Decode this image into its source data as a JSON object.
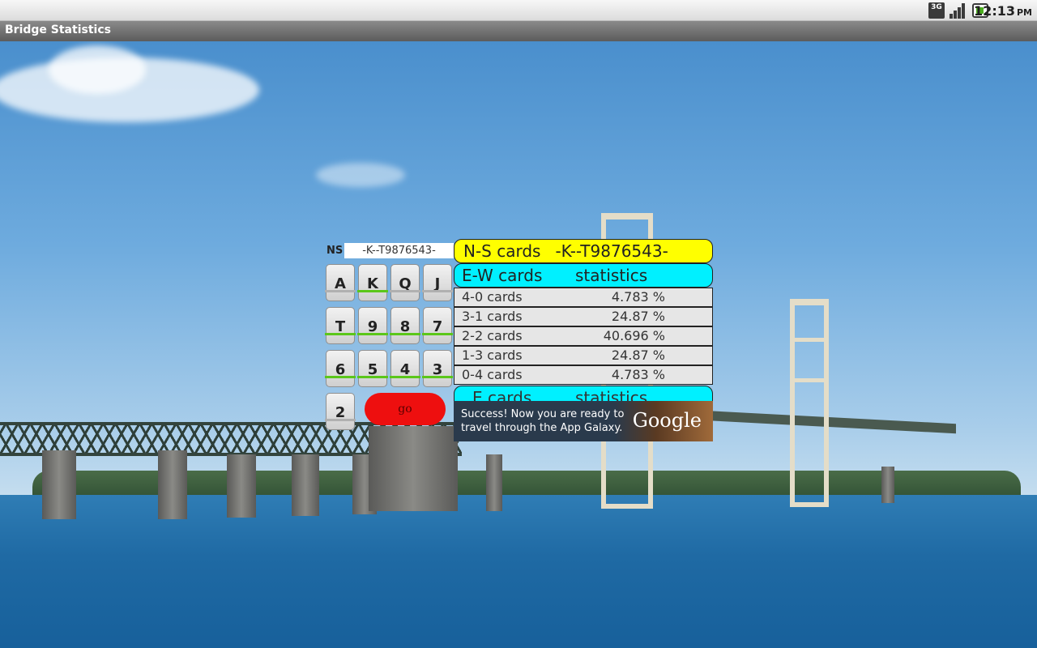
{
  "status_bar": {
    "network": "3G",
    "time": "12:13",
    "ampm": "PM"
  },
  "app": {
    "title": "Bridge Statistics"
  },
  "input": {
    "label": "NS",
    "value": "-K--T9876543-"
  },
  "keys": [
    {
      "label": "A",
      "selected": false
    },
    {
      "label": "K",
      "selected": true
    },
    {
      "label": "Q",
      "selected": false
    },
    {
      "label": "J",
      "selected": false
    },
    {
      "label": "T",
      "selected": true
    },
    {
      "label": "9",
      "selected": true
    },
    {
      "label": "8",
      "selected": true
    },
    {
      "label": "7",
      "selected": true
    },
    {
      "label": "6",
      "selected": true
    },
    {
      "label": "5",
      "selected": true
    },
    {
      "label": "4",
      "selected": true
    },
    {
      "label": "3",
      "selected": true
    },
    {
      "label": "2",
      "selected": false
    }
  ],
  "go_label": "go",
  "ns_header": {
    "label": "N-S cards",
    "value": "-K--T9876543-"
  },
  "ew_header": {
    "label": "E-W cards",
    "stats": "statistics"
  },
  "rows": [
    {
      "dist": "4-0 cards",
      "pct": "4.783 %"
    },
    {
      "dist": "3-1 cards",
      "pct": "24.87 %"
    },
    {
      "dist": "2-2 cards",
      "pct": "40.696 %"
    },
    {
      "dist": "1-3 cards",
      "pct": "24.87 %"
    },
    {
      "dist": "0-4 cards",
      "pct": "4.783 %"
    }
  ],
  "e_header": {
    "label": "E cards",
    "stats": "statistics"
  },
  "ad": {
    "text": "Success! Now you are ready to travel through the App Galaxy.",
    "brand": "Google"
  },
  "colors": {
    "ns_header": "#ffff00",
    "ew_header": "#00f0ff",
    "go_button": "#ee0f0f",
    "key_selected": "#5bc71a"
  }
}
